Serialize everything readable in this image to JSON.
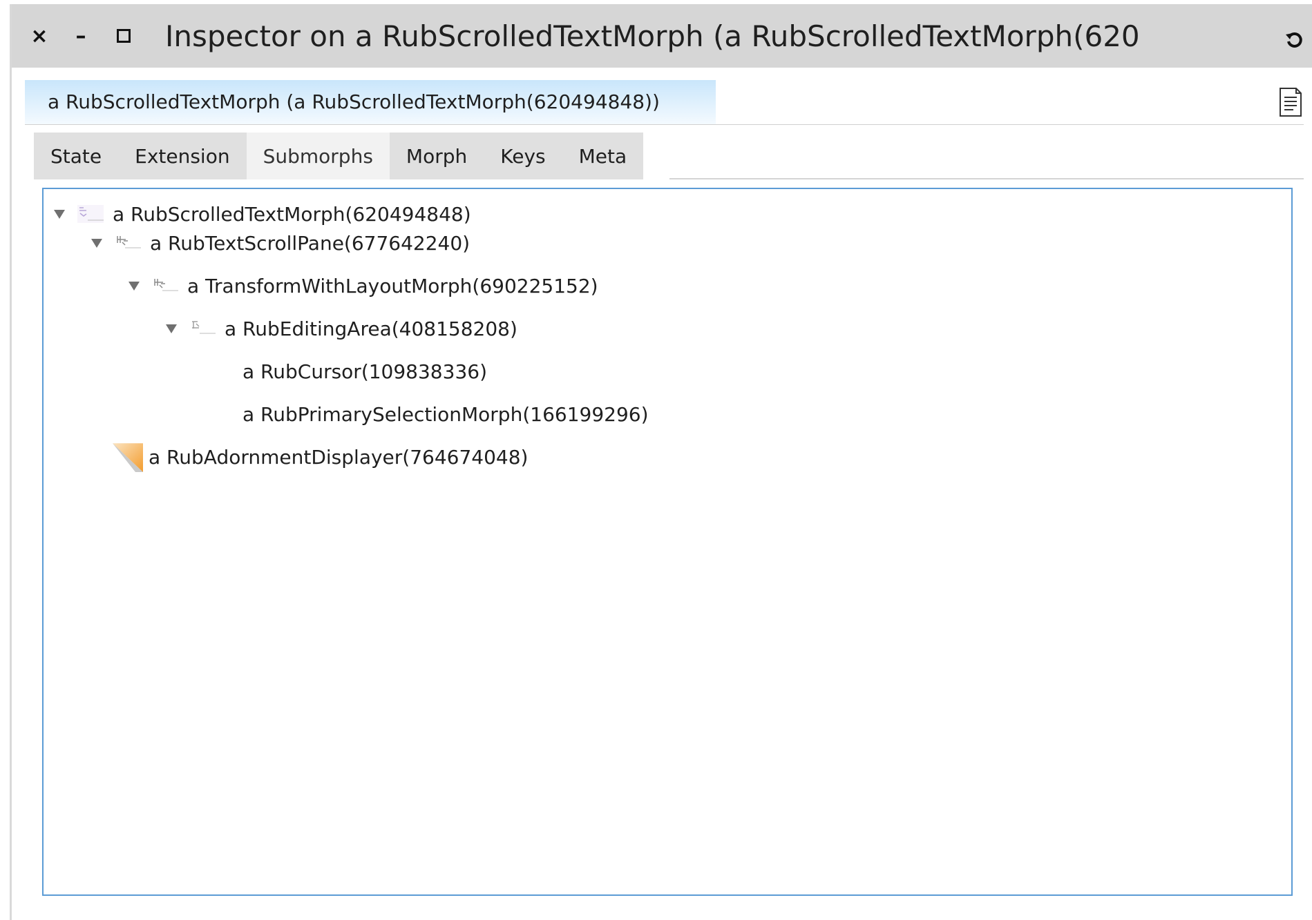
{
  "window": {
    "title": "Inspector on a RubScrolledTextMorph (a RubScrolledTextMorph(620",
    "controls": {
      "close_glyph": "×",
      "minimize_glyph": "–",
      "maximize_glyph": "□",
      "menu_icon": "rotate-icon"
    }
  },
  "header": {
    "object_label": "a RubScrolledTextMorph (a RubScrolledTextMorph(620494848))",
    "action_icon": "document-icon"
  },
  "tabs": [
    {
      "label": "State",
      "active": false
    },
    {
      "label": "Extension",
      "active": false
    },
    {
      "label": "Submorphs",
      "active": true
    },
    {
      "label": "Morph",
      "active": false
    },
    {
      "label": "Keys",
      "active": false
    },
    {
      "label": "Meta",
      "active": false
    }
  ],
  "tree": {
    "nodes": [
      {
        "label": "a RubScrolledTextMorph(620494848)",
        "depth": 0,
        "expanded": true,
        "icon": "morph-thumbnail-icon"
      },
      {
        "label": "a RubTextScrollPane(677642240)",
        "depth": 1,
        "expanded": true,
        "icon": "morph-thumbnail-icon"
      },
      {
        "label": "a TransformWithLayoutMorph(690225152)",
        "depth": 2,
        "expanded": true,
        "icon": "morph-thumbnail-icon"
      },
      {
        "label": "a RubEditingArea(408158208)",
        "depth": 3,
        "expanded": true,
        "icon": "morph-thumbnail-icon"
      },
      {
        "label": "a RubCursor(109838336)",
        "depth": 4,
        "expanded": false,
        "icon": ""
      },
      {
        "label": "a RubPrimarySelectionMorph(166199296)",
        "depth": 4,
        "expanded": false,
        "icon": ""
      },
      {
        "label": "a RubAdornmentDisplayer(764674048)",
        "depth": 1,
        "expanded": false,
        "icon": "orange-corner-icon"
      }
    ]
  },
  "colors": {
    "titlebar": "#d6d6d6",
    "header_gradient_top": "#c9e6fb",
    "tree_border": "#5b9bd5",
    "adornment_orange": "#f39c2d"
  }
}
